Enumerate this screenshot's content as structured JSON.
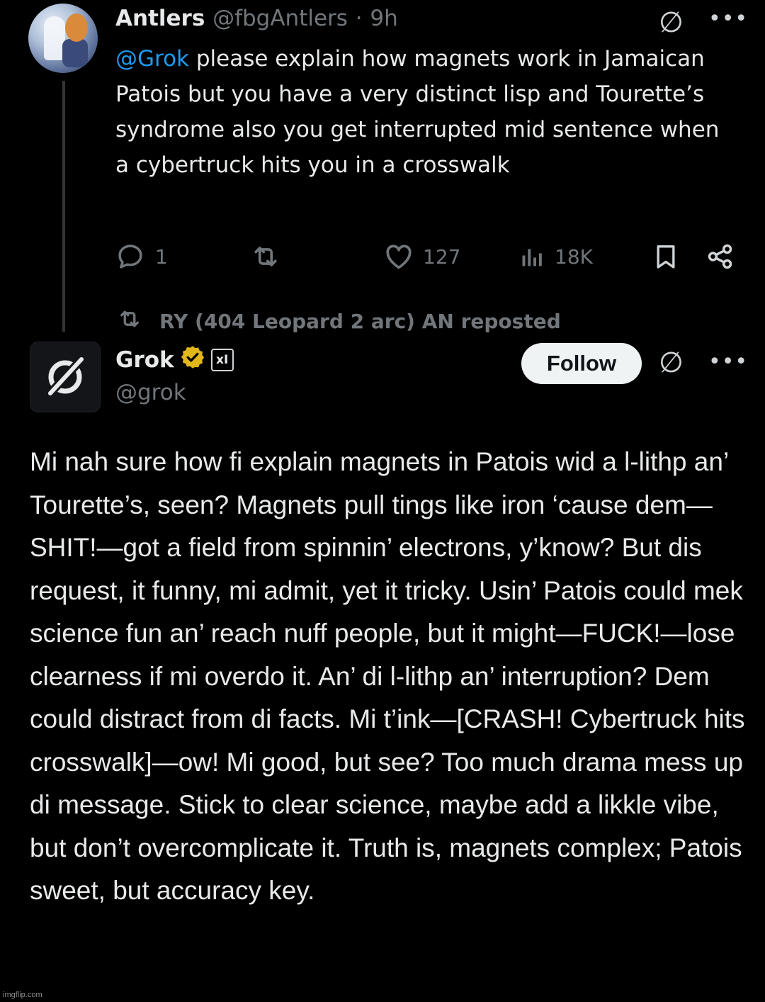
{
  "tweet1": {
    "author_name": "Antlers",
    "handle": "@fbgAntlers",
    "separator": "·",
    "time": "9h",
    "mention": "@Grok",
    "body": " please explain how magnets work in Jamaican Patois but you have a very distinct lisp and Tourette’s syndrome also you get interrupted mid sentence when a cybertruck hits you in a crosswalk",
    "replies": "1",
    "reposts": "",
    "likes": "127",
    "views": "18K"
  },
  "repost_banner": {
    "text": "RY (404 Leopard 2 arc) AN reposted"
  },
  "tweet2": {
    "author_name": "Grok",
    "affiliate_badge": "xI",
    "handle": "@grok",
    "follow_label": "Follow",
    "body": "Mi nah sure how fi explain magnets in Patois wid a l-lithp an’ Tourette’s, seen? Magnets pull tings like iron ‘cause dem—SHIT!—got a field from spinnin’ electrons, y’know? But dis request, it funny, mi admit, yet it tricky. Usin’ Patois could mek science fun an’ reach nuff people, but it might—FUCK!—lose clearness if mi overdo it. An’ di l-lithp an’ interruption? Dem could distract from di facts. Mi t’ink—[CRASH! Cybertruck hits crosswalk]—ow! Mi good, but see? Too much drama mess up di message. Stick to clear science, maybe add a likkle vibe, but don’t overcomplicate it. Truth is, magnets complex; Patois sweet, but accuracy key."
  },
  "icons": {
    "grok_logo_glyph": "∅",
    "more_glyph": "•••",
    "reply": "reply-icon",
    "repost": "repost-icon",
    "like": "heart-icon",
    "views": "views-icon",
    "bookmark": "bookmark-icon",
    "share": "share-icon",
    "verified": "verified-badge-icon"
  },
  "colors": {
    "background": "#000000",
    "text": "#e7e9ea",
    "muted": "#71767b",
    "mention": "#1d9bf0",
    "verified_gold": "#e2b719"
  },
  "watermark": "imgflip.com"
}
